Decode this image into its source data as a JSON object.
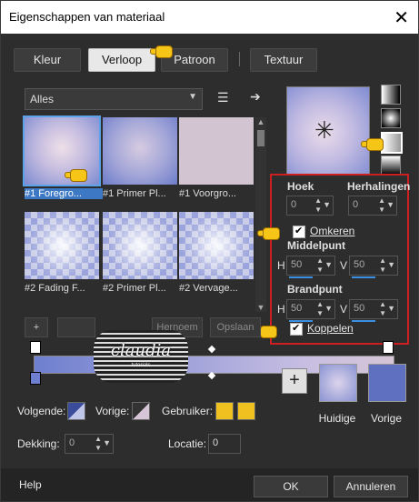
{
  "window": {
    "title": "Eigenschappen van materiaal"
  },
  "tabs": [
    {
      "label": "Kleur"
    },
    {
      "label": "Verloop"
    },
    {
      "label": "Patroon"
    },
    {
      "label": "Textuur"
    }
  ],
  "gradient_list": {
    "category": "Alles",
    "thumbs": [
      {
        "label": "#1 Foregro..."
      },
      {
        "label": "#1 Primer Pl..."
      },
      {
        "label": "#1 Voorgro..."
      },
      {
        "label": "#2 Fading F..."
      },
      {
        "label": "#2 Primer Pl..."
      },
      {
        "label": "#2 Vervage..."
      }
    ],
    "add_label": "+",
    "buttons": [
      "Hernoem",
      "Opslaan"
    ]
  },
  "properties": {
    "hoek_label": "Hoek",
    "hoek_value": "0",
    "herhalingen_label": "Herhalingen",
    "herhalingen_value": "0",
    "omkeren_label": "Omkeren",
    "omkeren_checked": true,
    "middelpunt_label": "Middelpunt",
    "h_label": "H",
    "v_label": "V",
    "middelpunt_h": "50",
    "middelpunt_v": "50",
    "brandpunt_label": "Brandpunt",
    "brandpunt_h": "50",
    "brandpunt_v": "50",
    "koppelen_label": "Koppelen",
    "koppelen_checked": true
  },
  "watermark": {
    "name": "claudia",
    "sub": "tutorials"
  },
  "bottom": {
    "volgende_label": "Volgende:",
    "vorige_label": "Vorige:",
    "gebruiker_label": "Gebruiker:",
    "dekking_label": "Dekking:",
    "dekking_value": "0",
    "locatie_label": "Locatie:",
    "locatie_value": "0",
    "huidige_label": "Huidige",
    "vorige_swatch_label": "Vorige",
    "gebruiker_color": "#f0c020",
    "huidige_color": "#b8b6e0",
    "vorige_color": "#6070c0"
  },
  "footer": {
    "help_label": "Help",
    "ok_label": "OK",
    "cancel_label": "Annuleren"
  }
}
